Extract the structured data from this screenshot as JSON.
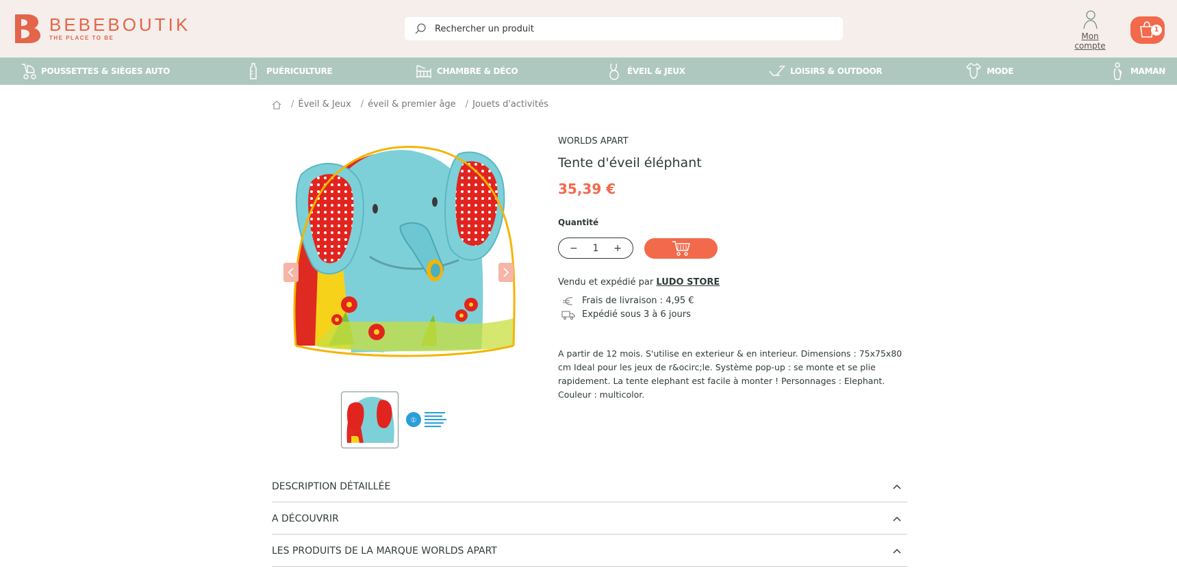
{
  "header": {
    "logo_name": "BEBEBOUTIK",
    "logo_tagline": "THE PLACE TO BE",
    "search_placeholder": "Rechercher un produit",
    "account_label": "Mon compte",
    "cart_count": "1"
  },
  "nav": {
    "items": [
      {
        "label": "POUSSETTES & SIÈGES AUTO",
        "icon": "stroller-icon"
      },
      {
        "label": "PUÉRICULTURE",
        "icon": "bottle-icon"
      },
      {
        "label": "CHAMBRE & DÉCO",
        "icon": "crib-icon"
      },
      {
        "label": "ÉVEIL & JEUX",
        "icon": "rabbit-icon"
      },
      {
        "label": "LOISIRS & OUTDOOR",
        "icon": "sled-icon"
      },
      {
        "label": "MODE",
        "icon": "bodysuit-icon"
      },
      {
        "label": "MAMAN",
        "icon": "mother-icon"
      }
    ]
  },
  "breadcrumb": {
    "home_icon": "home-icon",
    "items": [
      "Éveil & Jeux",
      "éveil & premier âge",
      "Jouets d'activités"
    ]
  },
  "product": {
    "brand": "WORLDS APART",
    "title": "Tente d'éveil éléphant",
    "price": "35,39 €",
    "quantity_label": "Quantité",
    "quantity_value": "1",
    "minus": "−",
    "plus": "+",
    "seller_prefix": "Vendu et expédié par",
    "seller_name": "LUDO STORE",
    "shipping_fee": "Frais de livraison : 4,95 €",
    "shipping_delay": "Expédié sous 3 à 6 jours",
    "description": "A partir de 12 mois. S'utilise en exterieur & en interieur. Dimensions : 75x75x80 cm Ideal pour les jeux de r&ocirc;le. Système pop-up : se monte et se plie rapidement. La tente elephant est facile à monter ! Personnages : Elephant. Couleur : multicolor."
  },
  "accordions": [
    {
      "label": "DESCRIPTION DÉTAILLÉE"
    },
    {
      "label": "A DÉCOUVRIR"
    },
    {
      "label": "LES PRODUITS DE LA MARQUE WORLDS APART"
    }
  ],
  "colors": {
    "brand": "#e4654b",
    "accent": "#f2694b",
    "nav_bg": "#afc8bf",
    "header_bg": "#f5eeeb"
  }
}
